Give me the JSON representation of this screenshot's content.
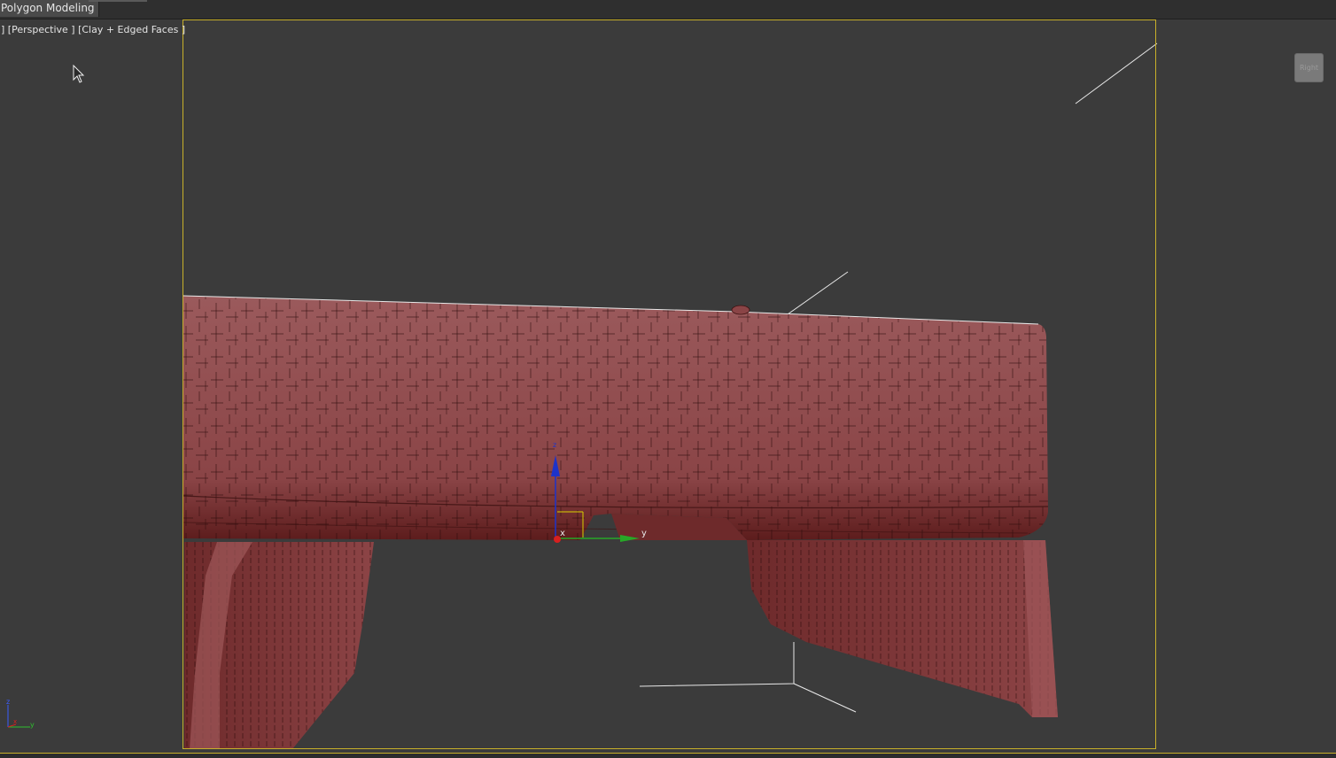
{
  "ribbon": {
    "tab_label": "Polygon Modeling"
  },
  "viewport": {
    "label": "] [Perspective ] [Clay + Edged Faces ]",
    "viewcube_face": "Right"
  },
  "gizmo": {
    "x_label": "x",
    "y_label": "y",
    "z_label": "z"
  },
  "axis_tripod": {
    "z_label": "z",
    "y_label": "y",
    "x_label": "x"
  },
  "colors": {
    "viewport_bg": "#3b3b3b",
    "model_fill": "#8f4a4c",
    "safe_frame": "#c8b02a",
    "gizmo_x": "#d81f1f",
    "gizmo_y": "#27a827",
    "gizmo_z": "#1d33c9"
  },
  "icons": [
    "mouse-cursor-icon",
    "viewcube-icon",
    "axis-tripod-icon",
    "transform-gizmo-icon"
  ]
}
